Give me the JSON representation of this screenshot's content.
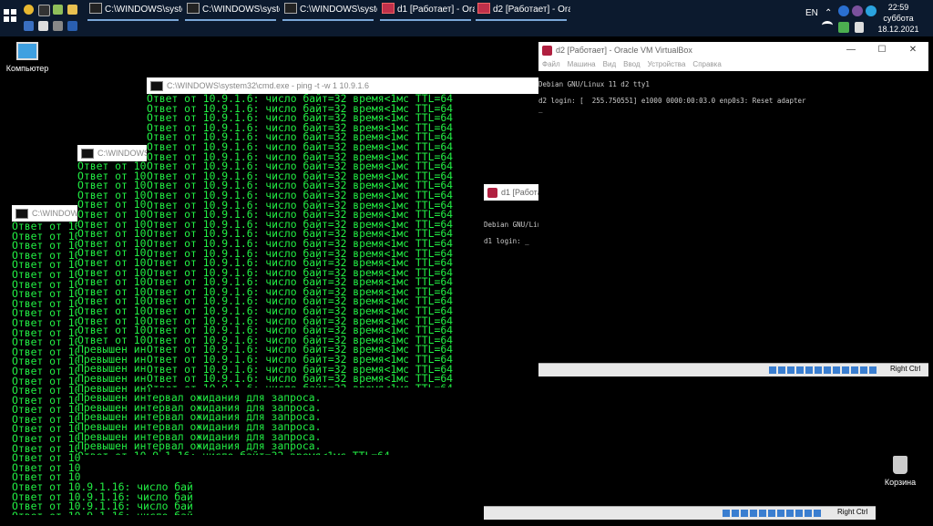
{
  "taskbar": {
    "tasks": [
      {
        "label": "C:\\WINDOWS\\system...",
        "type": "cmd"
      },
      {
        "label": "C:\\WINDOWS\\system...",
        "type": "cmd"
      },
      {
        "label": "C:\\WINDOWS\\system...",
        "type": "cmd"
      },
      {
        "label": "d1 [Работает] - Oracl...",
        "type": "vbox"
      },
      {
        "label": "d2 [Работает] - Oracl...",
        "type": "vbox"
      }
    ],
    "lang": "EN",
    "clock": {
      "time": "22:59",
      "day": "суббота",
      "date": "18.12.2021"
    }
  },
  "desktop": {
    "computer_label": "Компьютер",
    "recycle_label": "Корзина"
  },
  "cmd_main": {
    "title": "C:\\WINDOWS\\system32\\cmd.exe - ping  -t -w 1 10.9.1.6",
    "lines_text": "Ответ от 10.9.1.6: число байт=32 время<1мс TTL=64\nОтвет от 10.9.1.6: число байт=32 время<1мс TTL=64\nОтвет от 10.9.1.6: число байт=32 время<1мс TTL=64\nОтвет от 10.9.1.6: число байт=32 время<1мс TTL=64\nОтвет от 10.9.1.6: число байт=32 время<1мс TTL=64\nОтвет от 10.9.1.6: число байт=32 время<1мс TTL=64\nОтвет от 10.9.1.6: число байт=32 время<1мс TTL=64\nОтвет от 10.9.1.6: число байт=32 время<1мс TTL=64\nОтвет от 10.9.1.6: число байт=32 время<1мс TTL=64\nОтвет от 10.9.1.6: число байт=32 время<1мс TTL=64\nОтвет от 10.9.1.6: число байт=32 время<1мс TTL=64\nОтвет от 10.9.1.6: число байт=32 время<1мс TTL=64\nОтвет от 10.9.1.6: число байт=32 время<1мс TTL=64\nОтвет от 10.9.1.6: число байт=32 время<1мс TTL=64\nОтвет от 10.9.1.6: число байт=32 время<1мс TTL=64\nОтвет от 10.9.1.6: число байт=32 время<1мс TTL=64\nОтвет от 10.9.1.6: число байт=32 время<1мс TTL=64\nОтвет от 10.9.1.6: число байт=32 время<1мс TTL=64\nОтвет от 10.9.1.6: число байт=32 время<1мс TTL=64\nОтвет от 10.9.1.6: число байт=32 время<1мс TTL=64\nОтвет от 10.9.1.6: число байт=32 время<1мс TTL=64\nОтвет от 10.9.1.6: число байт=32 время<1мс TTL=64\nОтвет от 10.9.1.6: число байт=32 время<1мс TTL=64\nОтвет от 10.9.1.6: число байт=32 время<1мс TTL=64\nОтвет от 10.9.1.6: число байт=32 время<1мс TTL=64\nОтвет от 10.9.1.6: число байт=32 время<1мс TTL=64\nОтвет от 10.9.1.6: число байт=32 время<1мс TTL=64\nОтвет от 10.9.1.6: число байт=32 время<1мс TTL=64\nОтвет от 10.9.1.6: число байт=32 время<1мс TTL=64\nОтвет от 10.9.1.6: число байт=32 время<1мс TTL=64\nОтвет от 10.9.1.6: число байт=32 время<1мс TTL=64\nОтвет от 10.9.1.6: число байт=32 время<1мс TTL=64"
  },
  "cmd_mid": {
    "title": "C:\\WINDOWS\\system32\\cmd.exe",
    "lines_text": "Ответ от 10\nОтвет от 10\nОтвет от 10\nОтвет от 10\nОтвет от 10\nОтвет от 10\nОтвет от 10\nОтвет от 10\nОтвет от 10\nОтвет от 10\nОтвет от 10\nОтвет от 10\nОтвет от 10\nОтвет от 10\nОтвет от 10\nОтвет от 10\nОтвет от 10\nОтвет от 10\nОтвет от 10\nПревышен инт\nПревышен инт\nПревышен инт\nПревышен инт\nПревышен инт\nПревышен интервал ожидания для запроса.\nПревышен интервал ожидания для запроса.\nПревышен интервал ожидания для запроса.\nПревышен интервал ожидания для запроса.\nПревышен интервал ожидания для запроса.\nПревышен интервал ожидания для запроса.\nОтвет от 10.9.1.16: число байт=32 время<1мс TTL=64"
  },
  "cmd_left": {
    "title": "C:\\WINDOWS\\",
    "lines_text": "Ответ от 10\nОтвет от 10\nОтвет от 10\nОтвет от 10\nОтвет от 10\nОтвет от 10\nОтвет от 10\nОтвет от 10\nОтвет от 10\nОтвет от 10\nОтвет от 10\nОтвет от 10\nОтвет от 10\nОтвет от 10\nОтвет от 10\nОтвет от 10\nОтвет от 10\nОтвет от 10\nОтвет от 10\nОтвет от 10\nОтвет от 10\nОтвет от 10\nОтвет от 10\nОтвет от 10\nОтвет от 10\nОтвет от 10\nОтвет от 10\nОтвет от 10.9.1.16: число байт=32 время<1мс TTL=64\nОтвет от 10.9.1.16: число байт=32 время<1мс TTL=64\nОтвет от 10.9.1.16: число байт=32 время<1мс TTL=64\nОтвет от 10.9.1.16: число байт=32 время<1мс TTL=64\nОтвет от 10.9.1.16: число байт=32 время<1мс TTL=64"
  },
  "vbox_d2": {
    "title": "d2 [Работает] - Oracle VM VirtualBox",
    "menu": [
      "Файл",
      "Машина",
      "Вид",
      "Ввод",
      "Устройства",
      "Справка"
    ],
    "screen_text": "Debian GNU/Linux 11 d2 tty1\n\nd2 login: [  255.750551] e1000 0000:00:03.0 enp0s3: Reset adapter\n_",
    "host_key": "Right Ctrl"
  },
  "vbox_d1": {
    "title": "d1 [Работает]",
    "screen_text": "Debian GNU/Linu\n\nd1 login: _",
    "host_key": "Right Ctrl"
  },
  "colors": {
    "console_text": "#22ee44",
    "taskbar": "#0c1a2e"
  }
}
